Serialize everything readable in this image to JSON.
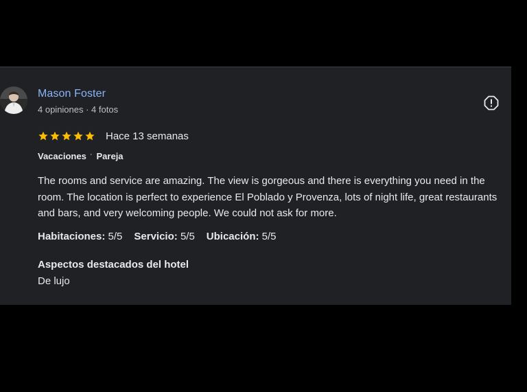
{
  "review": {
    "author": {
      "name": "Mason Foster",
      "meta": "4 opiniones · 4 fotos"
    },
    "rating": {
      "stars": 5,
      "max": 5,
      "date": "Hace 13 semanas"
    },
    "trip": {
      "type": "Vacaciones",
      "separator": "·",
      "companions": "Pareja"
    },
    "text": "The rooms and service are amazing. The view is gorgeous and there is everything you need in the room. The location is perfect to experience El Poblado y Provenza, lots of night life, great restaurants and bars, and very welcoming people. We could not ask for more.",
    "subratings": [
      {
        "label": "Habitaciones:",
        "value": "5/5"
      },
      {
        "label": "Servicio:",
        "value": "5/5"
      },
      {
        "label": "Ubicación:",
        "value": "5/5"
      }
    ],
    "highlights": {
      "title": "Aspectos destacados del hotel",
      "value": "De lujo"
    }
  },
  "icons": {
    "flag": "report-flag-icon",
    "star": "star-icon"
  },
  "colors": {
    "background": "#000000",
    "card": "#202124",
    "author_name": "#8ab4f8",
    "star": "#fbbc04",
    "text": "#e8eaed",
    "muted": "#bdc1c6"
  }
}
